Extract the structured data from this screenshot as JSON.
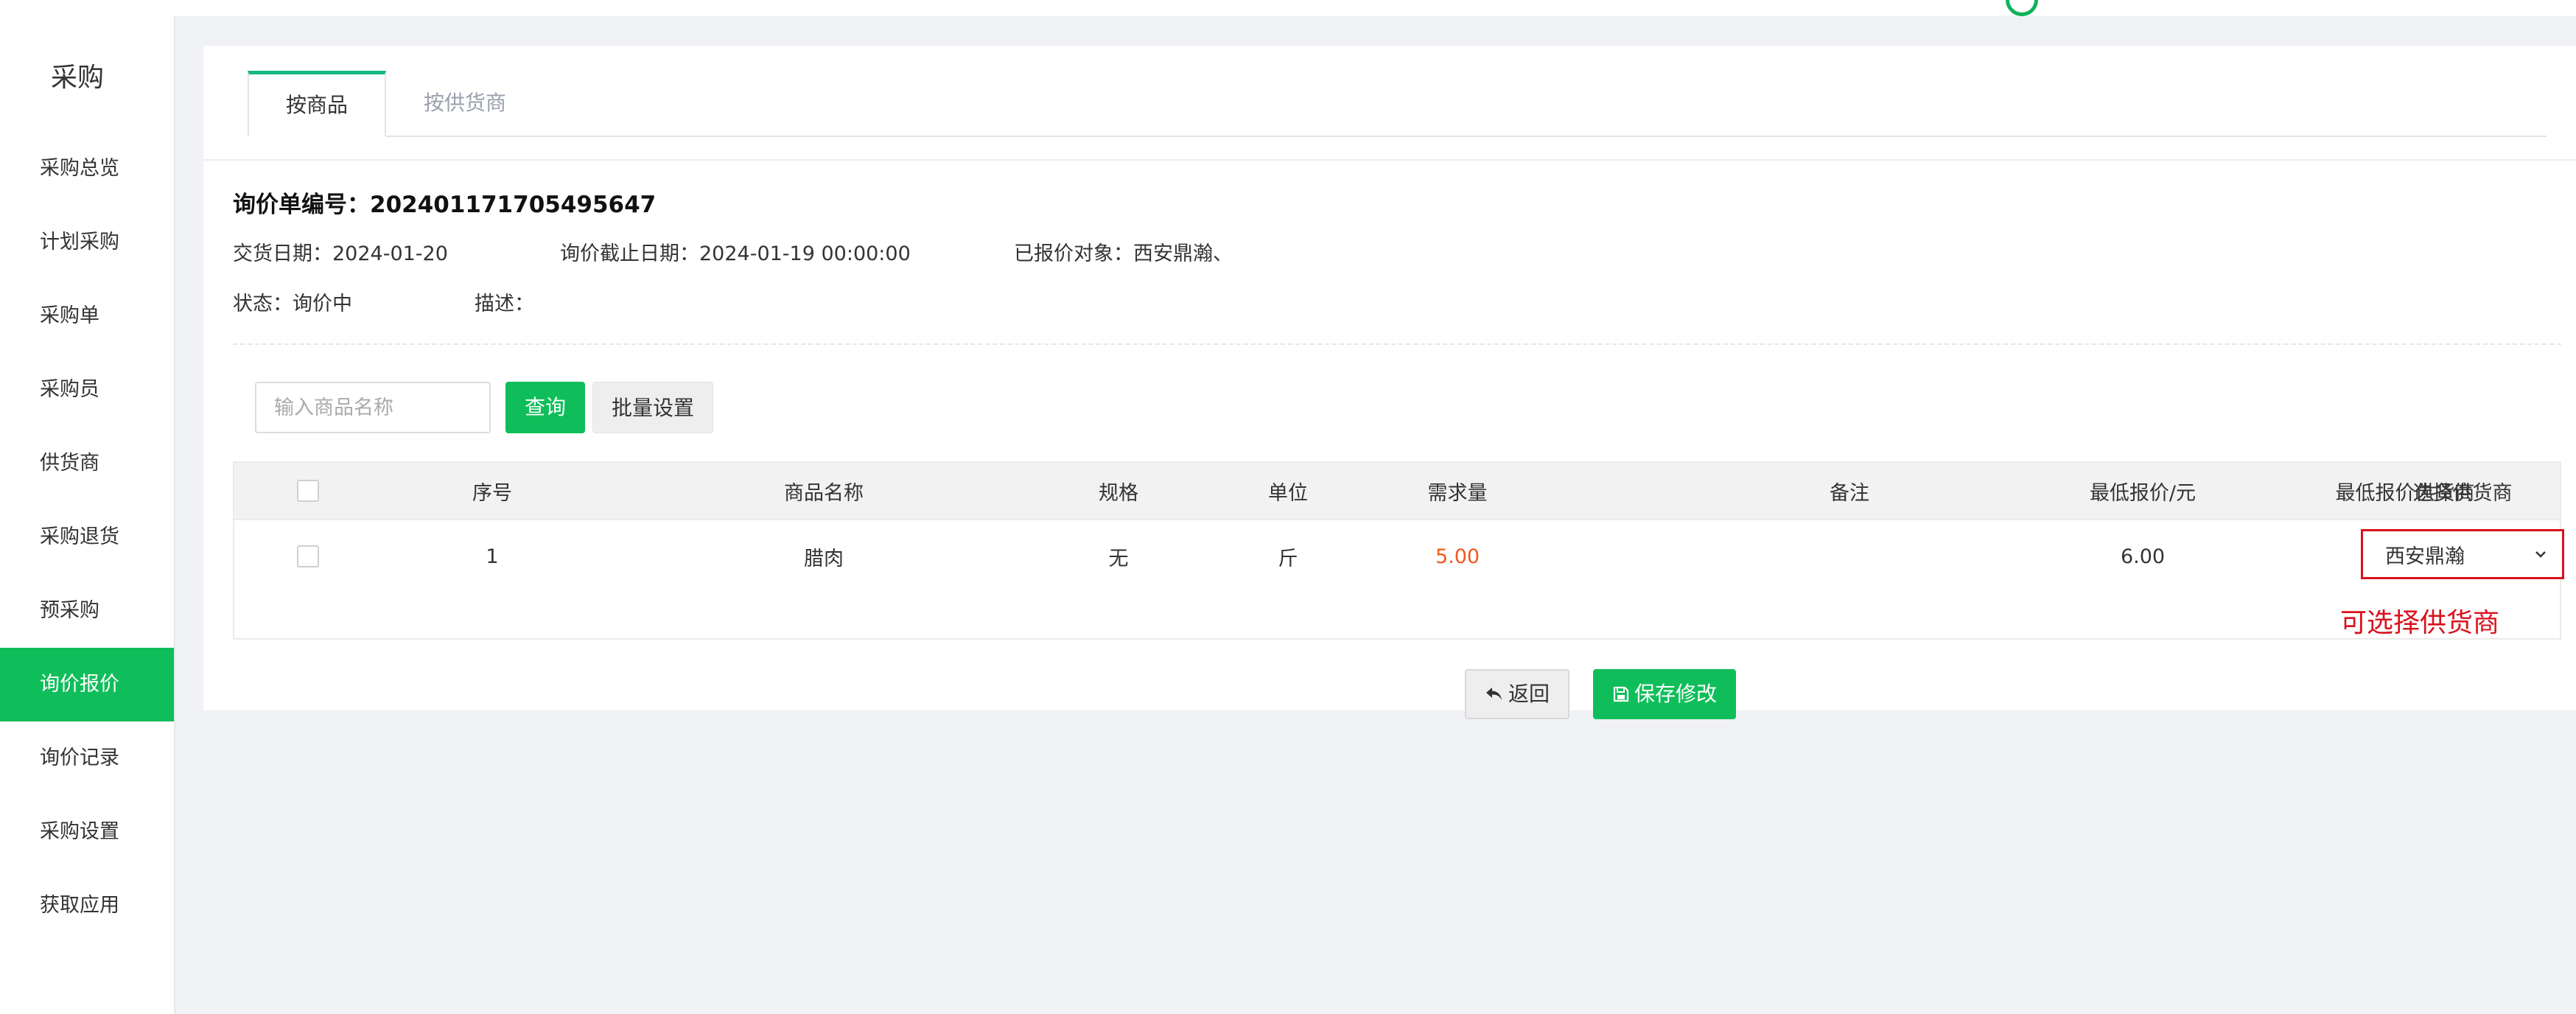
{
  "sidebar": {
    "title": "采购",
    "items": [
      {
        "label": "采购总览"
      },
      {
        "label": "计划采购"
      },
      {
        "label": "采购单"
      },
      {
        "label": "采购员"
      },
      {
        "label": "供货商"
      },
      {
        "label": "采购退货"
      },
      {
        "label": "预采购"
      },
      {
        "label": "询价报价",
        "active": true
      },
      {
        "label": "询价记录"
      },
      {
        "label": "采购设置"
      },
      {
        "label": "获取应用"
      }
    ]
  },
  "tabs": [
    {
      "label": "按商品",
      "active": true
    },
    {
      "label": "按供货商",
      "active": false
    }
  ],
  "order": {
    "number_label": "询价单编号：",
    "number": "202401171705495647",
    "delivery_label": "交货日期：",
    "delivery_date": "2024-01-20",
    "deadline_label": "询价截止日期：",
    "deadline": "2024-01-19 00:00:00",
    "quoted_label": "已报价对象：",
    "quoted": "西安鼎瀚、",
    "status_label": "状态：",
    "status": "询价中",
    "desc_label": "描述：",
    "desc": ""
  },
  "search": {
    "placeholder": "输入商品名称",
    "query_label": "查询",
    "batch_label": "批量设置"
  },
  "table": {
    "headers": [
      "序号",
      "商品名称",
      "规格",
      "单位",
      "需求量",
      "备注",
      "最低报价/元",
      "最低报价供货商",
      "选择供货商"
    ],
    "rows": [
      {
        "index": "1",
        "name": "腊肉",
        "spec": "无",
        "unit": "斤",
        "qty": "5.00",
        "note": "",
        "min_price": "6.00",
        "min_supplier": "西安鼎瀚",
        "selected_supplier": "西安鼎瀚"
      }
    ]
  },
  "hint": "可选择供货商",
  "actions": {
    "back_label": "返回",
    "save_label": "保存修改"
  },
  "colors": {
    "accent": "#0fbe5a",
    "tab_indicator": "#16b785",
    "highlight": "#d9121d",
    "qty": "#f0591e"
  }
}
